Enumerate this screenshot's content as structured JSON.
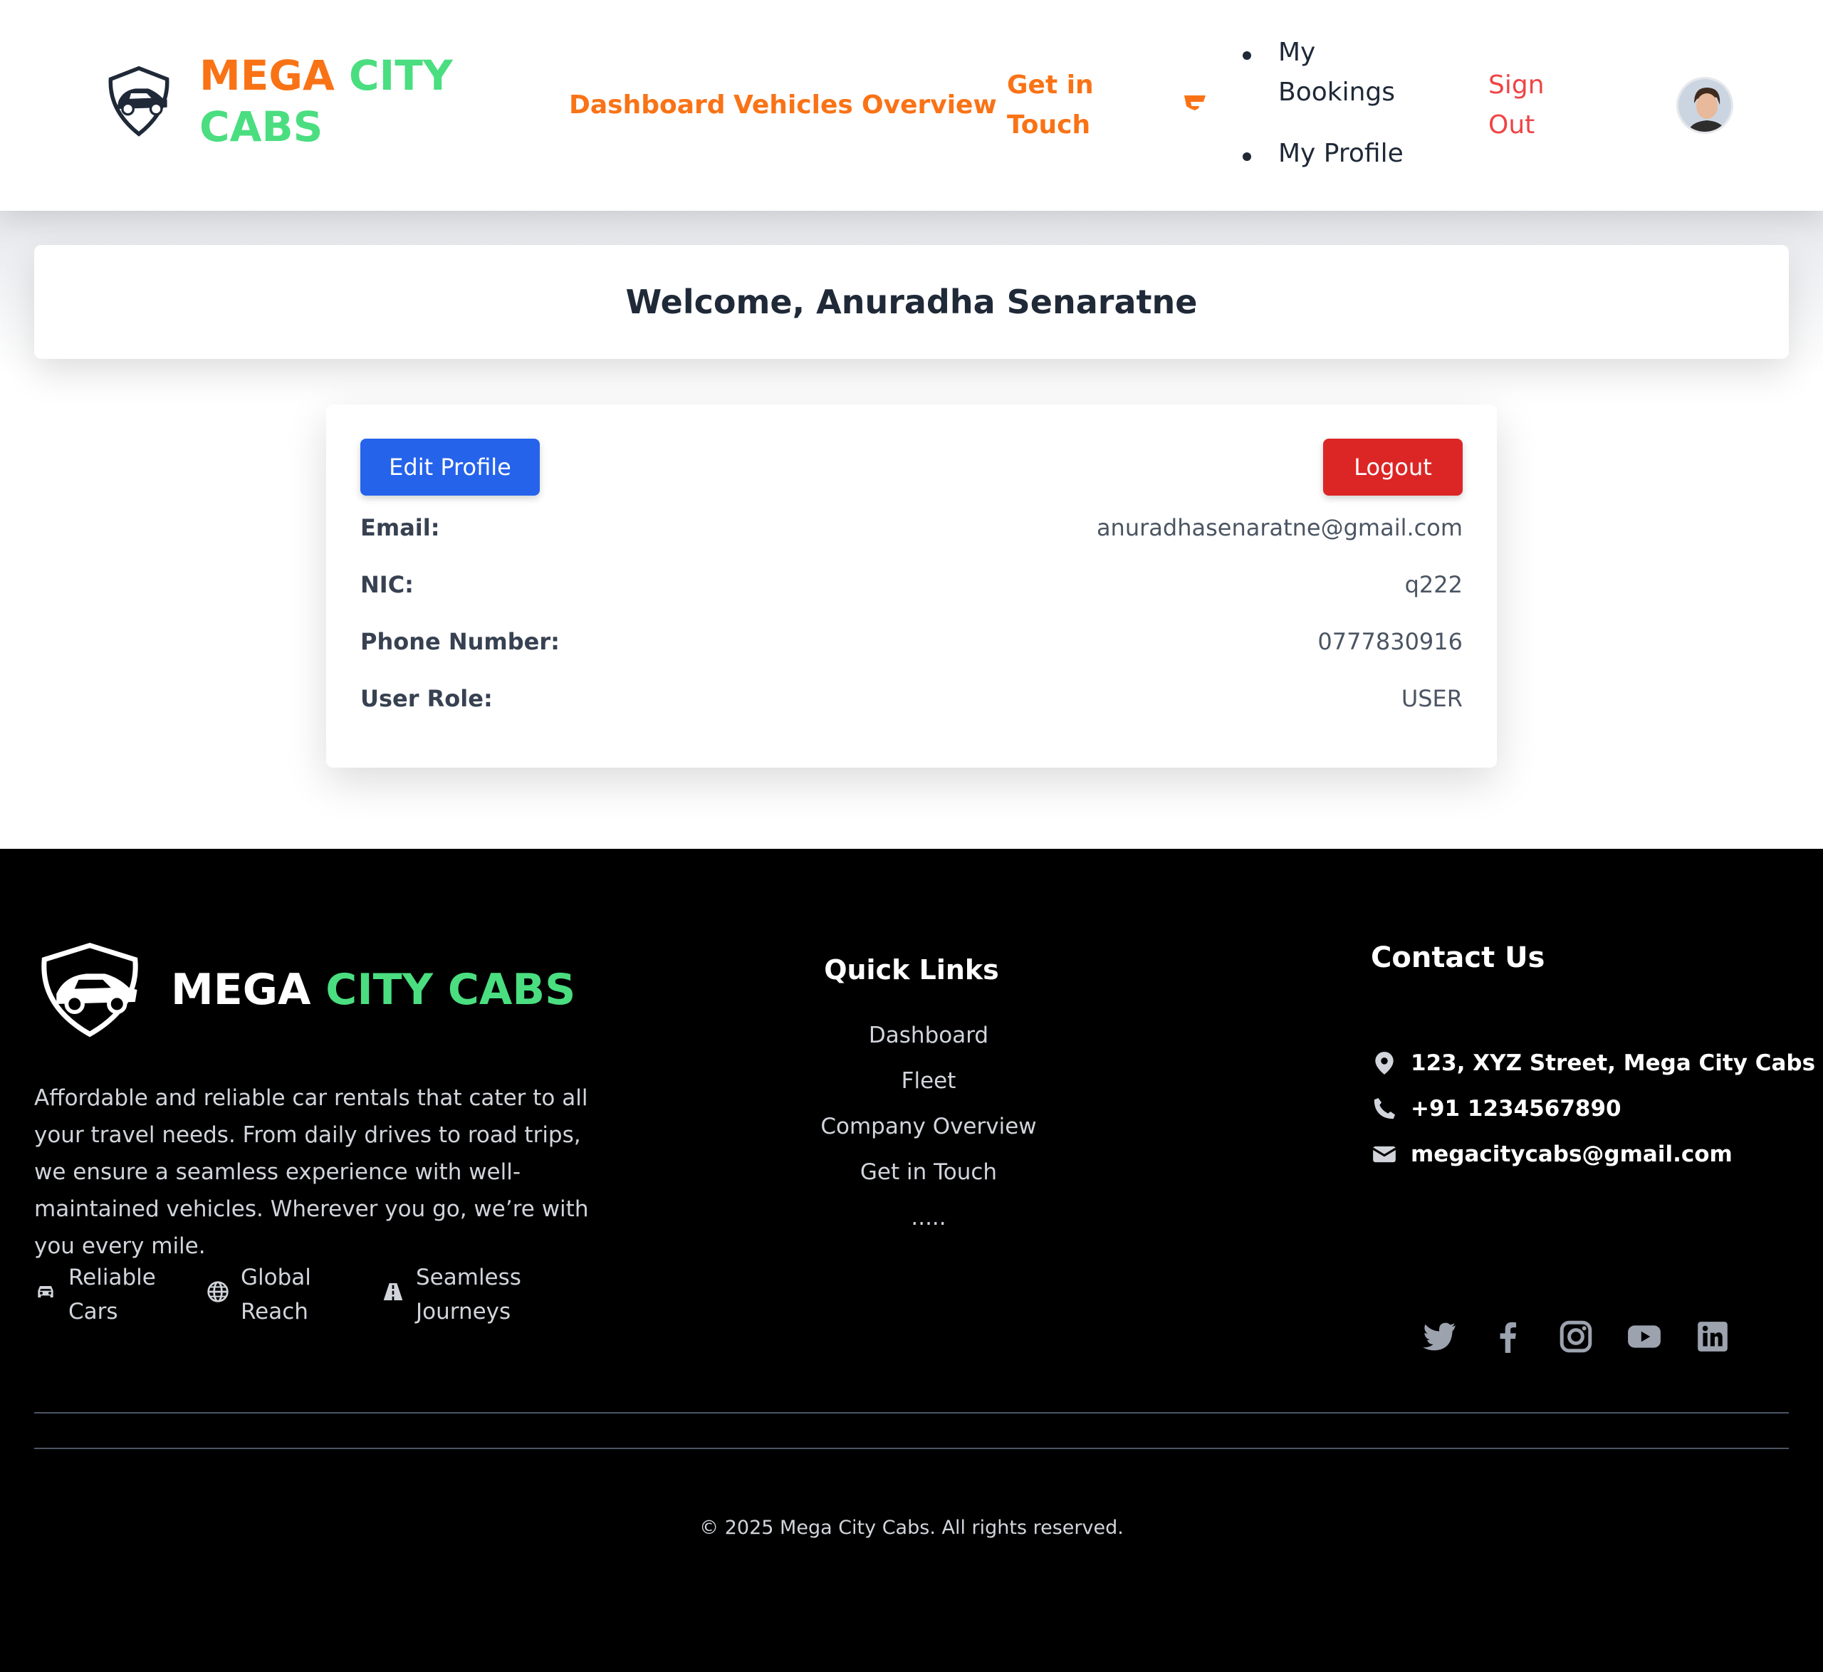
{
  "brand": {
    "word1": "MEGA",
    "word2": "CITY",
    "word3": "CABS"
  },
  "nav": {
    "links": [
      "Dashboard",
      "Vehicles",
      "Overview",
      "Get in Touch"
    ],
    "dropdown_items": [
      "My Bookings",
      "My Profile"
    ],
    "sign_out": "Sign Out"
  },
  "welcome": {
    "text": "Welcome, Anuradha Senaratne"
  },
  "profile": {
    "edit_button": "Edit Profile",
    "logout_button": "Logout",
    "fields": [
      {
        "label": "Email:",
        "value": "anuradhasenaratne@gmail.com"
      },
      {
        "label": "NIC:",
        "value": "q222"
      },
      {
        "label": "Phone Number:",
        "value": "0777830916"
      },
      {
        "label": "User Role:",
        "value": "USER"
      }
    ]
  },
  "footer": {
    "brand1": "MEGA",
    "brand2": "CITY CABS",
    "description": "Affordable and reliable car rentals that cater to all your travel needs. From daily drives to road trips, we ensure a seamless experience with well-maintained vehicles. Wherever you go, we’re with you every mile.",
    "features": [
      {
        "icon": "car-icon",
        "line1": "Reliable",
        "line2": "Cars"
      },
      {
        "icon": "globe-icon",
        "line1": "Global",
        "line2": "Reach"
      },
      {
        "icon": "road-icon",
        "line1": "Seamless",
        "line2": "Journeys"
      }
    ],
    "quick_links_title": "Quick Links",
    "quick_links": [
      "Dashboard",
      "Fleet",
      "Company Overview",
      "Get in Touch",
      "....."
    ],
    "contact_title": "Contact Us",
    "contact": {
      "address": "123, XYZ Street, Mega City Cabs",
      "phone": "+91 1234567890",
      "email": "megacitycabs@gmail.com"
    },
    "socials": [
      "twitter-icon",
      "facebook-icon",
      "instagram-icon",
      "youtube-icon",
      "linkedin-icon"
    ],
    "copyright": "© 2025 Mega City Cabs. All rights reserved."
  },
  "colors": {
    "brand_orange": "#f97316",
    "brand_green": "#4ade80",
    "edit_blue": "#2563eb",
    "logout_red": "#dc2626",
    "signout_red": "#ef4444",
    "footer_bg": "#000000"
  }
}
